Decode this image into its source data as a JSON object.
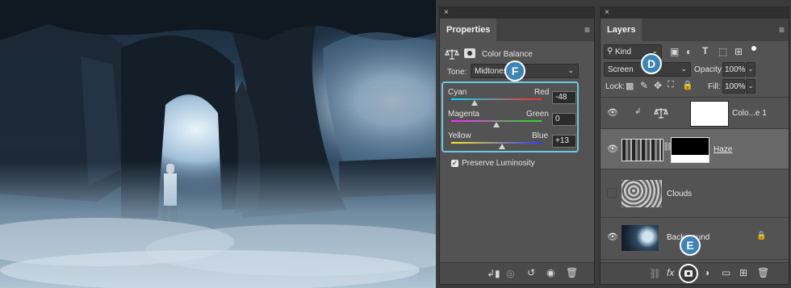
{
  "properties_panel": {
    "close_glyph": "×",
    "tab_label": "Properties",
    "adjustment_name": "Color Balance",
    "tone_label": "Tone:",
    "tone_value": "Midtones",
    "sliders": [
      {
        "left": "Cyan",
        "right": "Red",
        "value": "-48",
        "level": -48
      },
      {
        "left": "Magenta",
        "right": "Green",
        "value": "0",
        "level": 0
      },
      {
        "left": "Yellow",
        "right": "Blue",
        "value": "+13",
        "level": 13
      }
    ],
    "preserve_luminosity_label": "Preserve Luminosity",
    "preserve_luminosity_checked": true
  },
  "layers_panel": {
    "close_glyph": "×",
    "tab_label": "Layers",
    "filter_kind": "Kind",
    "blend_mode": "Screen",
    "opacity_label": "Opacity:",
    "opacity_value": "100%",
    "lock_label": "Lock:",
    "fill_label": "Fill:",
    "fill_value": "100%",
    "layers": [
      {
        "name": "Colo...e 1",
        "visible": true,
        "type": "adjustment"
      },
      {
        "name": "Haze",
        "visible": true,
        "type": "masked",
        "selected": true
      },
      {
        "name": "Clouds",
        "visible": false,
        "type": "pixel"
      },
      {
        "name": "Background",
        "visible": true,
        "type": "background",
        "locked": true
      }
    ],
    "footer_fx": "fx"
  },
  "callouts": {
    "d": "D",
    "e": "E",
    "f": "F"
  },
  "colors": {
    "accent_highlight": "#6ec6e6",
    "callout_fill": "#3d84b8",
    "panel_bg": "#535353"
  }
}
